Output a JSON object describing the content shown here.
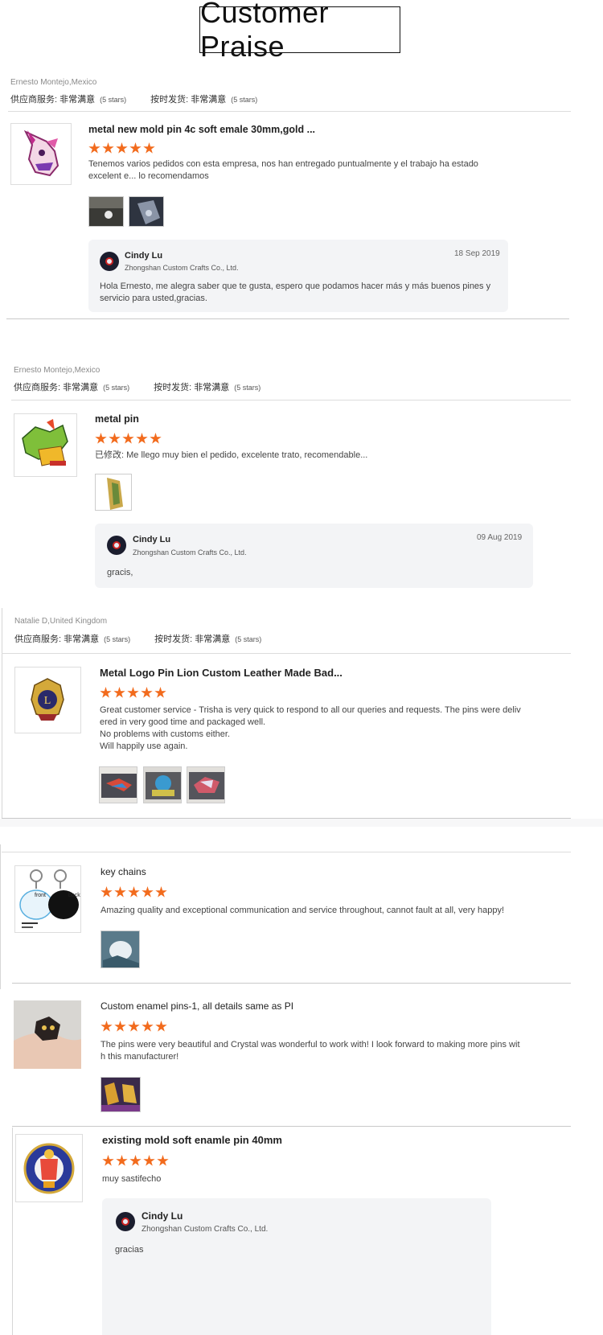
{
  "page_title": "Customer Praise",
  "colors": {
    "star": "#f26b1d",
    "reply_bg": "#f3f4f6"
  },
  "reviews": [
    {
      "reviewer": "Ernesto Montejo,Mexico",
      "service_label": "供应商服务:",
      "service_value": "非常满意",
      "service_stars": "(5 stars)",
      "delivery_label": "按时发货:",
      "delivery_value": "非常满意",
      "delivery_stars": "(5 stars)",
      "product": "metal new mold pin 4c soft emale 30mm,gold ...",
      "rating": 5,
      "text": "Tenemos varios pedidos con esta empresa, nos han entregado puntualmente y el trabajo ha estado excelent e... lo recomendamos",
      "reply": {
        "name": "Cindy Lu",
        "company": "Zhongshan Custom Crafts Co., Ltd.",
        "date": "18 Sep 2019",
        "message": "Hola Ernesto, me alegra saber que te gusta, espero que podamos hacer más y más buenos pines y servicio para usted,gracias."
      }
    },
    {
      "reviewer": "Ernesto Montejo,Mexico",
      "service_label": "供应商服务:",
      "service_value": "非常满意",
      "service_stars": "(5 stars)",
      "delivery_label": "按时发货:",
      "delivery_value": "非常满意",
      "delivery_stars": "(5 stars)",
      "product": "metal pin",
      "rating": 5,
      "text_prefix": "已修改:",
      "text": "Me llego muy bien el pedido, excelente trato, recomendable...",
      "reply": {
        "name": "Cindy Lu",
        "company": "Zhongshan Custom Crafts Co., Ltd.",
        "date": "09 Aug 2019",
        "message": "gracis,"
      }
    },
    {
      "reviewer": "Natalie D,United Kingdom",
      "service_label": "供应商服务:",
      "service_value": "非常满意",
      "service_stars": "(5 stars)",
      "delivery_label": "按时发货:",
      "delivery_value": "非常满意",
      "delivery_stars": "(5 stars)",
      "product": "Metal Logo Pin Lion Custom Leather Made Bad...",
      "rating": 5,
      "text_lines": [
        "Great customer service - Trisha is very quick to respond to all our queries and requests. The pins were deliv",
        "ered in very good time and packaged well.",
        "No problems with customs either.",
        "Will happily use again."
      ]
    },
    {
      "product": "key chains",
      "rating": 5,
      "text": "Amazing quality and exceptional communication and service throughout, cannot fault at all, very happy!",
      "thumb_front": "front",
      "thumb_back": "back"
    },
    {
      "product": "Custom enamel pins-1, all details same as PI",
      "rating": 5,
      "text_lines": [
        "The pins were very beautiful and Crystal was wonderful to work with! I look forward to making more pins wit",
        "h this manufacturer!"
      ]
    },
    {
      "product": "existing mold soft enamle pin 40mm",
      "rating": 5,
      "text": "muy sastifecho",
      "reply": {
        "name": "Cindy Lu",
        "company": "Zhongshan Custom Crafts Co., Ltd.",
        "message": "gracias"
      }
    }
  ]
}
